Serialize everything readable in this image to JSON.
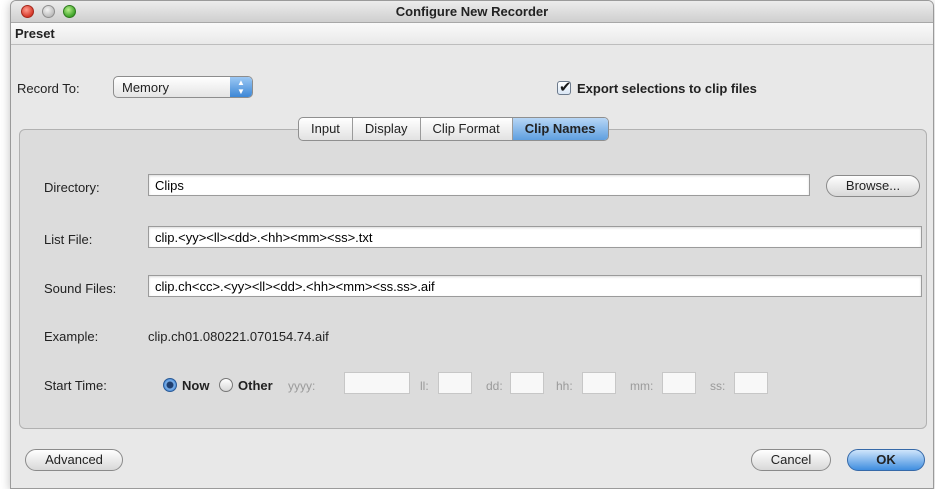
{
  "window": {
    "title": "Configure New Recorder"
  },
  "menu": {
    "preset": "Preset"
  },
  "record": {
    "label": "Record To:",
    "value": "Memory"
  },
  "export": {
    "checked": true,
    "label": "Export selections to clip files"
  },
  "tabs": [
    {
      "label": "Input",
      "active": false
    },
    {
      "label": "Display",
      "active": false
    },
    {
      "label": "Clip Format",
      "active": false
    },
    {
      "label": "Clip Names",
      "active": true
    }
  ],
  "directory": {
    "label": "Directory:",
    "value": "Clips",
    "browse": "Browse..."
  },
  "list_file": {
    "label": "List File:",
    "value": "clip.<yy><ll><dd>.<hh><mm><ss>.txt"
  },
  "sound_files": {
    "label": "Sound Files:",
    "value": "clip.ch<cc>.<yy><ll><dd>.<hh><mm><ss.ss>.aif"
  },
  "example": {
    "label": "Example:",
    "value": "clip.ch01.080221.070154.74.aif"
  },
  "start_time": {
    "label": "Start Time:",
    "now_label": "Now",
    "other_label": "Other",
    "selected": "Now",
    "fields": [
      {
        "label": "yyyy:",
        "value": ""
      },
      {
        "label": "ll:",
        "value": ""
      },
      {
        "label": "dd:",
        "value": ""
      },
      {
        "label": "hh:",
        "value": ""
      },
      {
        "label": "mm:",
        "value": ""
      },
      {
        "label": "ss:",
        "value": ""
      }
    ]
  },
  "buttons": {
    "advanced": "Advanced",
    "cancel": "Cancel",
    "ok": "OK"
  },
  "colors": {
    "accent": "#3f8ee0",
    "window_bg": "#e8e8e8",
    "panel_bg": "#dcdcdc"
  },
  "icons": {
    "close": "close-icon",
    "minimize": "minimize-icon",
    "zoom": "zoom-icon",
    "popup_arrows": "chevron-updown-icon",
    "checkmark": "checkmark-icon"
  }
}
